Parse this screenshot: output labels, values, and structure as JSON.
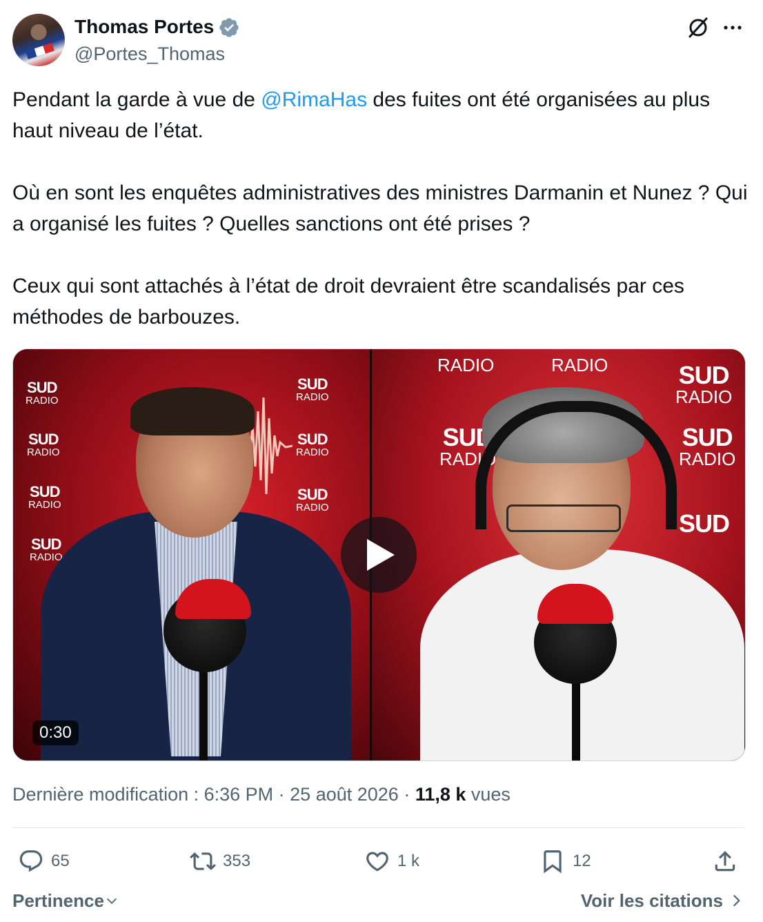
{
  "author": {
    "display_name": "Thomas Portes",
    "handle": "@Portes_Thomas",
    "verified_color": "#829aab"
  },
  "tweet": {
    "p1_before": "Pendant la garde à vue de ",
    "p1_mention": "@RimaHas",
    "p1_after": " des fuites ont été organisées au plus haut niveau de l’état.",
    "p2": "Où en sont les enquêtes administratives des ministres Darmanin et Nunez ? Qui a organisé les fuites ? Quelles sanctions ont été prises ?",
    "p3": "Ceux qui sont attachés à l’état de droit devraient être scandalisés par ces méthodes de barbouzes."
  },
  "media": {
    "duration": "0:30",
    "logo_sud": "SUD",
    "logo_radio": "RADIO"
  },
  "meta": {
    "edited_label": "Dernière modification : 6:36 PM · 25 août 2026 · ",
    "views_count": "11,8 k",
    "views_label": " vues"
  },
  "actions": {
    "replies": "65",
    "reposts": "353",
    "likes": "1 k",
    "bookmarks": "12"
  },
  "footer": {
    "sort_label": "Pertinence",
    "quotes_label": "Voir les citations"
  },
  "colors": {
    "link": "#1d9bf0",
    "secondary_text": "#536471",
    "primary_text": "#0f1419"
  },
  "icons": [
    "verified-badge-icon",
    "grok-icon",
    "more-icon",
    "play-icon",
    "reply-icon",
    "repost-icon",
    "like-icon",
    "bookmark-icon",
    "share-icon",
    "chevron-down-icon",
    "chevron-right-icon"
  ]
}
